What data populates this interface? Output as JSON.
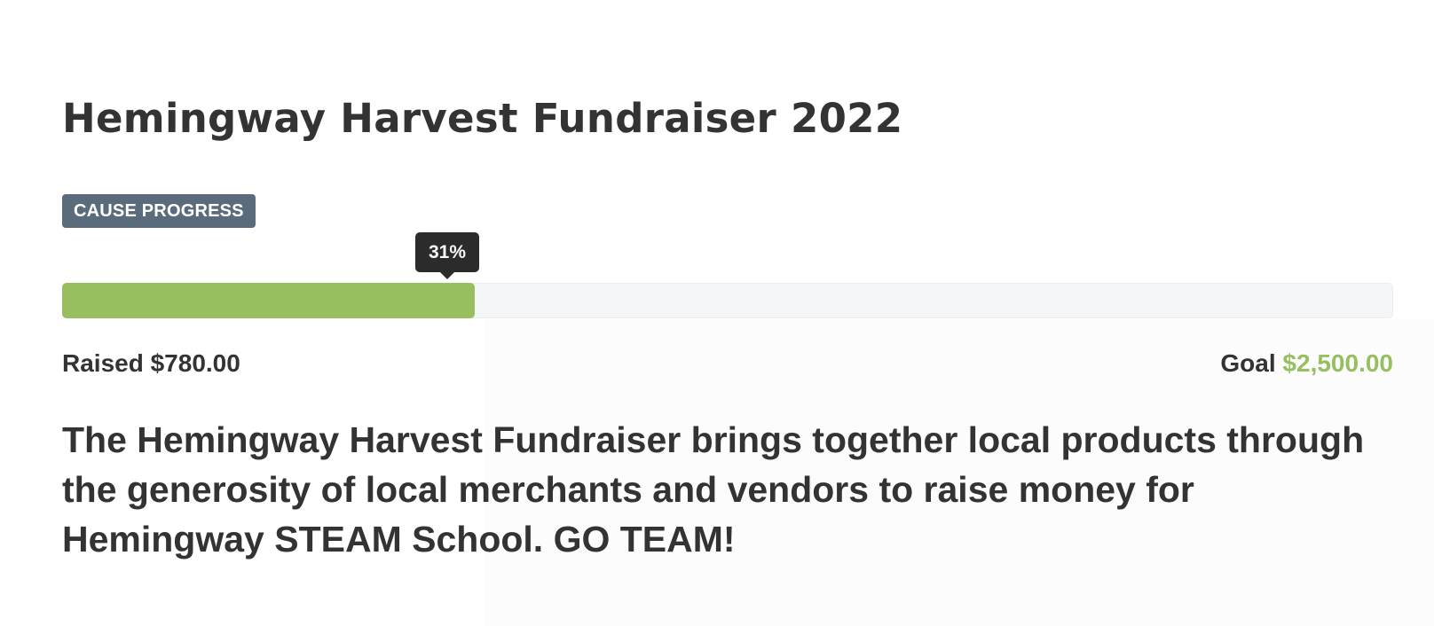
{
  "title": "Hemingway Harvest Fundraiser 2022",
  "badge_label": "CAUSE PROGRESS",
  "progress": {
    "percent": 31,
    "percent_label": "31%"
  },
  "raised": {
    "label": "Raised",
    "amount": "$780.00"
  },
  "goal": {
    "label": "Goal",
    "amount": "$2,500.00"
  },
  "description": "The Hemingway Harvest Fundraiser brings together local products through the generosity of local merchants and vendors to raise money for Hemingway STEAM School. GO TEAM!",
  "colors": {
    "accent": "#97bf60",
    "badge_bg": "#5a6b7b",
    "tooltip_bg": "#2b2b2b",
    "text": "#333333",
    "track": "#f4f5f7"
  }
}
